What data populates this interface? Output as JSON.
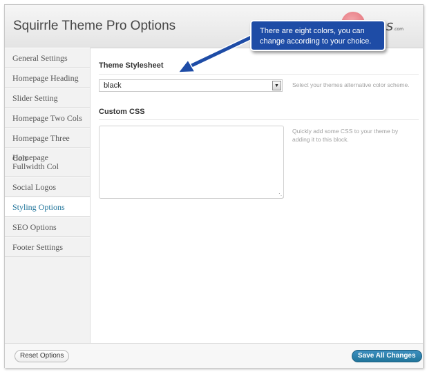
{
  "header": {
    "title": "Squirrle Theme Pro Options",
    "logo_text": "mes",
    "logo_sub": ".com"
  },
  "sidebar": {
    "items": [
      {
        "label": "General Settings"
      },
      {
        "label": "Homepage Heading"
      },
      {
        "label": "Slider Setting"
      },
      {
        "label": "Homepage Two Cols"
      },
      {
        "label": "Homepage Three Cols"
      },
      {
        "label": "Homepage Fullwidth Col"
      },
      {
        "label": "Social Logos"
      },
      {
        "label": "Styling Options",
        "active": true
      },
      {
        "label": "SEO Options"
      },
      {
        "label": "Footer Settings"
      }
    ]
  },
  "main": {
    "stylesheet": {
      "title": "Theme Stylesheet",
      "selected": "black",
      "help": "Select your themes alternative color scheme."
    },
    "custom_css": {
      "title": "Custom CSS",
      "value": "",
      "help_line1": "Quickly add some CSS to your theme by",
      "help_line2": "adding it to this block."
    }
  },
  "footer": {
    "reset_label": "Reset Options",
    "save_label": "Save All Changes"
  },
  "callout": {
    "line1": "There are eight colors, you can",
    "line2": "change according to your choice."
  },
  "colors": {
    "accent": "#21759b",
    "callout_bg": "#1e4ca6",
    "logo": "#e26a73"
  }
}
